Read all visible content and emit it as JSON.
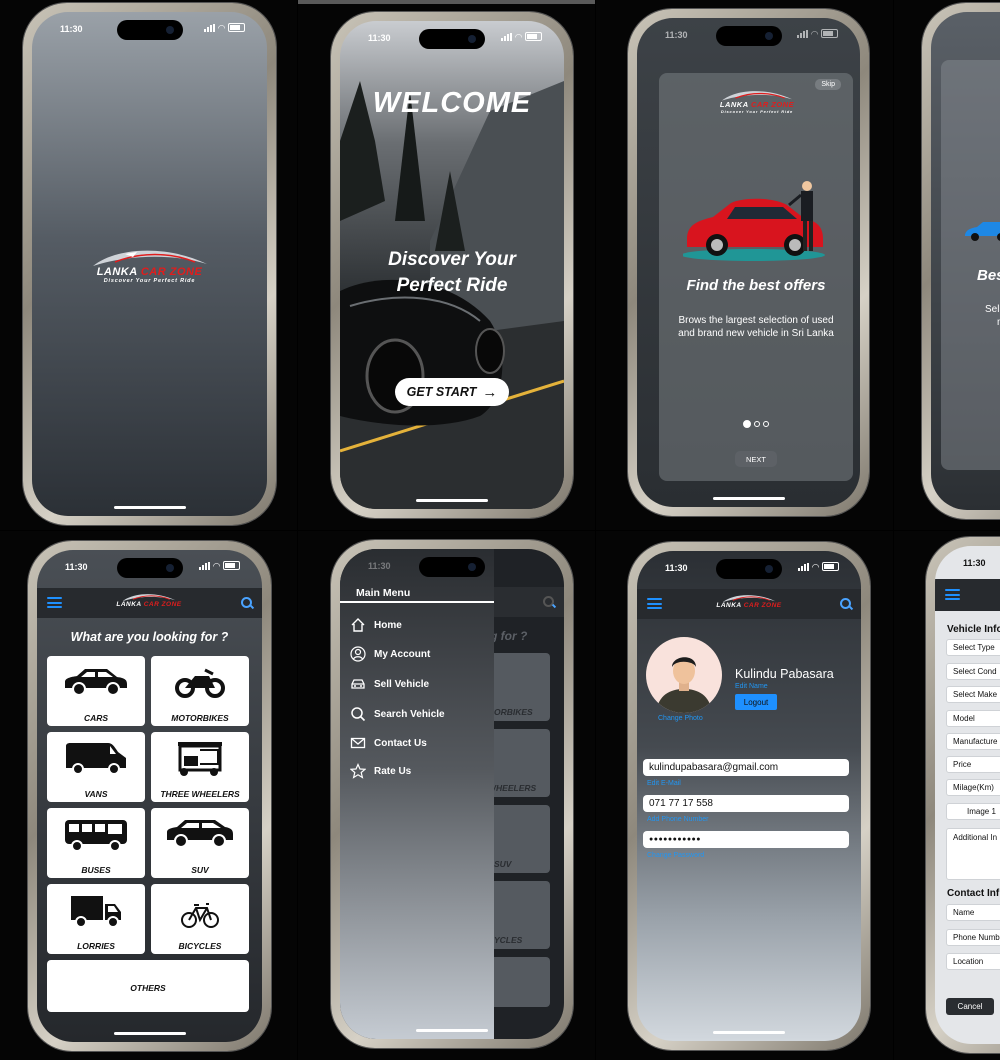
{
  "status": {
    "time": "11:30"
  },
  "brand": {
    "name_part1": "LANKA",
    "name_part2": "CAR ZONE",
    "tagline": "Discover Your Perfect Ride",
    "accent": "#e01d1d"
  },
  "welcome": {
    "title": "WELCOME",
    "headline_line1": "Discover Your",
    "headline_line2": "Perfect Ride",
    "start_button": "GET START"
  },
  "onboarding": {
    "skip": "Skip",
    "title": "Find the best offers",
    "body": "Brows the largest selection of used and brand new vehicle in Sri Lanka",
    "next": "NEXT",
    "partial_title": "Bes",
    "partial_body_line1": "Sel",
    "partial_body_line2": "m"
  },
  "categories": {
    "heading": "What are you looking for ?",
    "items": [
      {
        "label": "CARS",
        "icon": "car-icon"
      },
      {
        "label": "MOTORBIKES",
        "icon": "motorbike-icon"
      },
      {
        "label": "VANS",
        "icon": "van-icon"
      },
      {
        "label": "THREE WHEELERS",
        "icon": "three-wheeler-icon"
      },
      {
        "label": "BUSES",
        "icon": "bus-icon"
      },
      {
        "label": "SUV",
        "icon": "suv-icon"
      },
      {
        "label": "LORRIES",
        "icon": "lorry-icon"
      },
      {
        "label": "BICYCLES",
        "icon": "bicycle-icon"
      },
      {
        "label": "OTHERS",
        "icon": ""
      }
    ]
  },
  "drawer": {
    "title": "Main Menu",
    "items": [
      {
        "label": "Home",
        "icon": "home-icon"
      },
      {
        "label": "My Account",
        "icon": "account-icon"
      },
      {
        "label": "Sell Vehicle",
        "icon": "car-front-icon"
      },
      {
        "label": "Search Vehicle",
        "icon": "search-icon"
      },
      {
        "label": "Contact Us",
        "icon": "mail-icon"
      },
      {
        "label": "Rate Us",
        "icon": "star-icon"
      }
    ],
    "behind_heading": "g for ?",
    "behind_labels": [
      "ORBIKES",
      "WHEELERS",
      "SUV",
      "YCLES"
    ]
  },
  "profile": {
    "name": "Kulindu Pabasara",
    "edit_name": "Edit Name",
    "logout": "Logout",
    "change_photo": "Change Photo",
    "email": "kulindupabasara@gmail.com",
    "edit_email": "Edit E-Mail",
    "phone": "071 77 17 558",
    "add_phone": "Add Phone Number",
    "password": "●●●●●●●●●●●",
    "change_password": "Change Password",
    "link_color": "#2196f3"
  },
  "sell": {
    "vehicle_section": "Vehicle Info",
    "fields": [
      "Select Type",
      "Select Cond",
      "Select Make",
      "Model",
      "Manufacture",
      "Price",
      "Milage(Km)",
      "Image 1",
      "Additional In"
    ],
    "contact_section": "Contact Inf",
    "contact_fields": [
      "Name",
      "Phone Numb",
      "Location"
    ],
    "cancel": "Cancel"
  }
}
